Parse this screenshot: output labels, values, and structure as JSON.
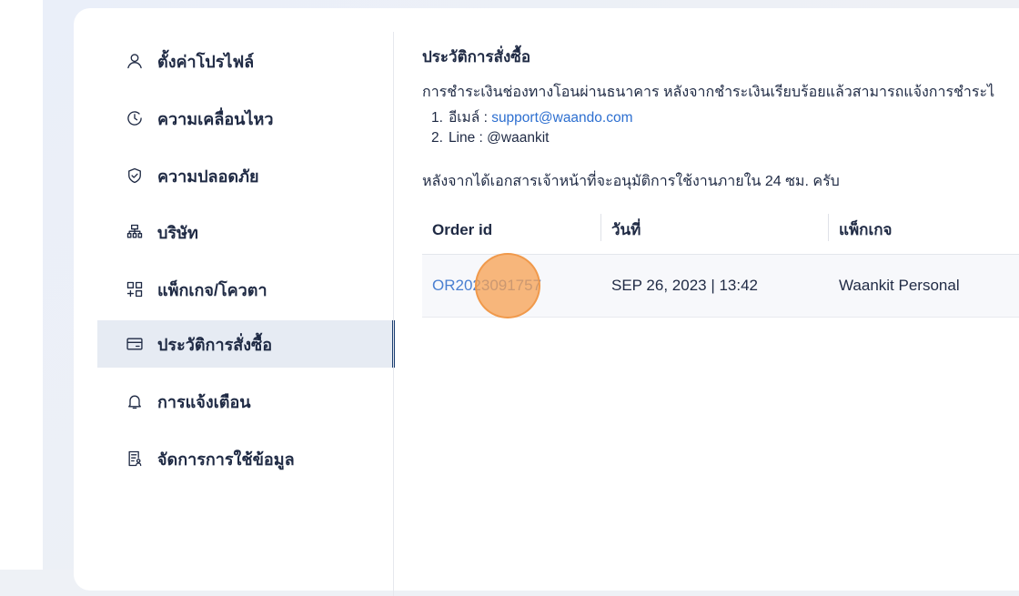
{
  "sidebar": {
    "items": [
      {
        "label": "ตั้งค่าโปรไฟล์",
        "icon": "user-icon",
        "active": false
      },
      {
        "label": "ความเคลื่อนไหว",
        "icon": "clock-icon",
        "active": false
      },
      {
        "label": "ความปลอดภัย",
        "icon": "shield-check-icon",
        "active": false
      },
      {
        "label": "บริษัท",
        "icon": "org-chart-icon",
        "active": false
      },
      {
        "label": "แพ็กเกจ/โควตา",
        "icon": "package-grid-icon",
        "active": false
      },
      {
        "label": "ประวัติการสั่งซื้อ",
        "icon": "credit-card-icon",
        "active": true
      },
      {
        "label": "การแจ้งเตือน",
        "icon": "bell-icon",
        "active": false
      },
      {
        "label": "จัดการการใช้ข้อมูล",
        "icon": "document-user-icon",
        "active": false
      }
    ]
  },
  "main": {
    "title": "ประวัติการสั่งซื้อ",
    "intro": "การชำระเงินช่องทางโอนผ่านธนาคาร หลังจากชำระเงินเรียบร้อยแล้วสามารถแจ้งการชำระไ",
    "contacts": [
      {
        "num": "1.",
        "label": "อีเมล์ : ",
        "value": "support@waando.com"
      },
      {
        "num": "2.",
        "label": "Line : ",
        "value": "@waankit"
      }
    ],
    "note": "หลังจากได้เอกสารเจ้าหน้าที่จะอนุมัติการใช้งานภายใน 24 ซม. ครับ",
    "table": {
      "headers": [
        "Order id",
        "วันที่",
        "แพ็กเกจ"
      ],
      "rows": [
        {
          "order_id": "OR2023091757",
          "date": "SEP 26, 2023 | 13:42",
          "package": "Waankit Personal"
        }
      ]
    }
  },
  "colors": {
    "accent": "#1c3f72",
    "link": "#2d6fd0",
    "active_bg": "#e6ebf3",
    "click_marker": "#f7a050"
  }
}
